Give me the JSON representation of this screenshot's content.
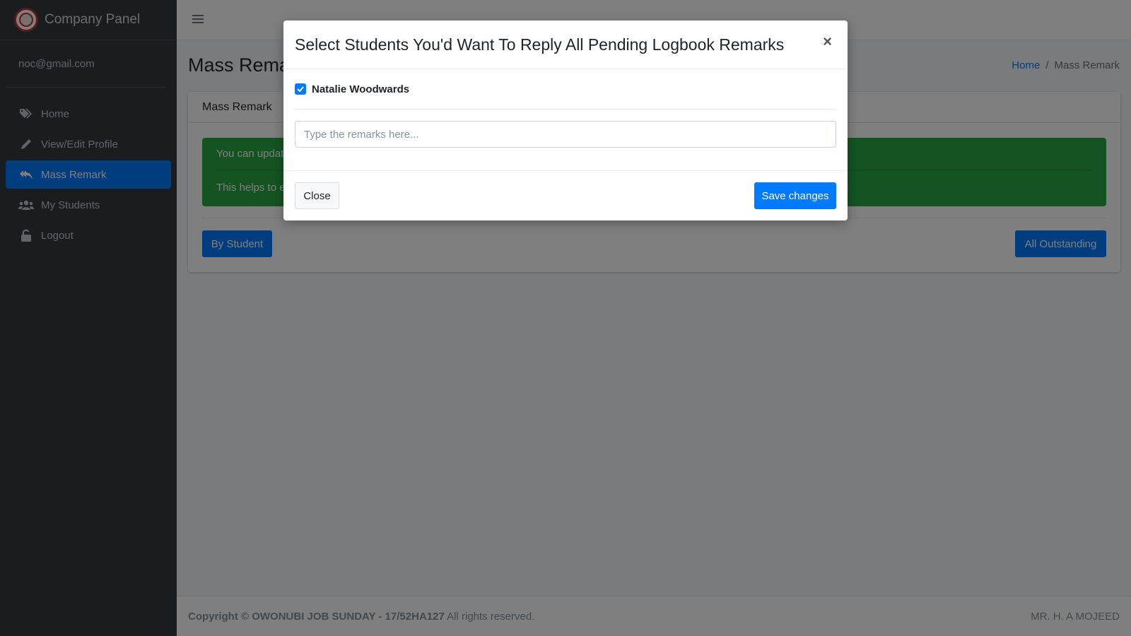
{
  "brand": {
    "name": "Company Panel"
  },
  "user": {
    "email": "noc@gmail.com"
  },
  "sidebar": {
    "items": [
      {
        "label": "Home",
        "icon": "tags-icon"
      },
      {
        "label": "View/Edit Profile",
        "icon": "pencil-icon"
      },
      {
        "label": "Mass Remark",
        "icon": "reply-all-icon",
        "active": true
      },
      {
        "label": "My Students",
        "icon": "users-icon"
      },
      {
        "label": "Logout",
        "icon": "unlock-icon"
      }
    ]
  },
  "header": {
    "page_title": "Mass Remark",
    "breadcrumb": {
      "home": "Home",
      "current": "Mass Remark"
    }
  },
  "card": {
    "title": "Mass Remark",
    "alert_line1": "You can update all pending logbook remarks at once.",
    "alert_line2": "This helps to easily reply students without going through each logbook.",
    "by_student_label": "By Student",
    "all_outstanding_label": "All Outstanding"
  },
  "footer": {
    "copyright_prefix": "Copyright © OWONUBI JOB SUNDAY - 17/52HA127",
    "copyright_suffix": "All rights reserved.",
    "right_text": "MR. H. A MOJEED"
  },
  "modal": {
    "title": "Select Students You'd Want To Reply All Pending Logbook Remarks",
    "close_symbol": "×",
    "students": [
      {
        "name": "Natalie Woodwards",
        "checked": true
      }
    ],
    "remarks_placeholder": "Type the remarks here...",
    "remarks_value": "",
    "close_label": "Close",
    "save_label": "Save changes"
  },
  "colors": {
    "primary": "#007bff",
    "sidebar_bg": "#343a40",
    "alert_success": "#28a745"
  }
}
